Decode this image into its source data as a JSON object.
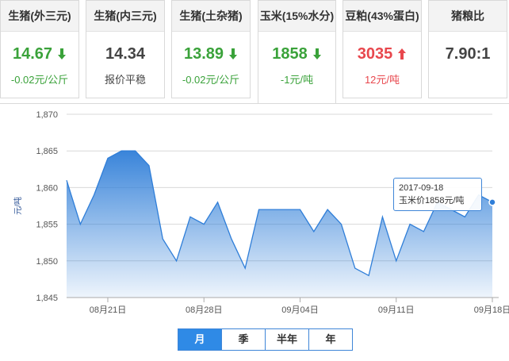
{
  "cards": [
    {
      "title": "生猪(外三元)",
      "value": "14.67",
      "trend": "down",
      "change": "-0.02元/公斤",
      "color": "green"
    },
    {
      "title": "生猪(内三元)",
      "value": "14.34",
      "trend": "flat",
      "change": "报价平稳",
      "color": "dark"
    },
    {
      "title": "生猪(土杂猪)",
      "value": "13.89",
      "trend": "down",
      "change": "-0.02元/公斤",
      "color": "green"
    },
    {
      "title": "玉米(15%水分)",
      "value": "1858",
      "trend": "down",
      "change": "-1元/吨",
      "color": "green"
    },
    {
      "title": "豆粕(43%蛋白)",
      "value": "3035",
      "trend": "up",
      "change": "12元/吨",
      "color": "red"
    },
    {
      "title": "猪粮比",
      "value": "7.90:1",
      "trend": "flat",
      "change": "",
      "color": "dark"
    }
  ],
  "tooltip": {
    "date": "2017-09-18",
    "text": "玉米价1858元/吨"
  },
  "period_buttons": [
    "月",
    "季",
    "半年",
    "年"
  ],
  "selected_period": "月",
  "chart_data": {
    "type": "area",
    "ylabel": "元/吨",
    "ylim": [
      1845,
      1870
    ],
    "yticks": [
      "1,845",
      "1,850",
      "1,855",
      "1,860",
      "1,865",
      "1,870"
    ],
    "xticks": [
      "08月21日",
      "08月28日",
      "09月04日",
      "09月11日",
      "09月18日"
    ],
    "x": [
      "08-18",
      "08-19",
      "08-20",
      "08-21",
      "08-22",
      "08-23",
      "08-24",
      "08-25",
      "08-26",
      "08-27",
      "08-28",
      "08-29",
      "08-30",
      "08-31",
      "09-01",
      "09-02",
      "09-03",
      "09-04",
      "09-05",
      "09-06",
      "09-07",
      "09-08",
      "09-09",
      "09-10",
      "09-11",
      "09-12",
      "09-13",
      "09-14",
      "09-15",
      "09-16",
      "09-17",
      "09-18"
    ],
    "values": [
      1861,
      1855,
      1859,
      1864,
      1865,
      1865,
      1863,
      1853,
      1850,
      1856,
      1855,
      1858,
      1853,
      1849,
      1857,
      1857,
      1857,
      1857,
      1854,
      1857,
      1855,
      1849,
      1848,
      1856,
      1850,
      1855,
      1854,
      1858,
      1857,
      1856,
      1859,
      1858
    ],
    "color": "#2f7ed8",
    "grid": true
  }
}
